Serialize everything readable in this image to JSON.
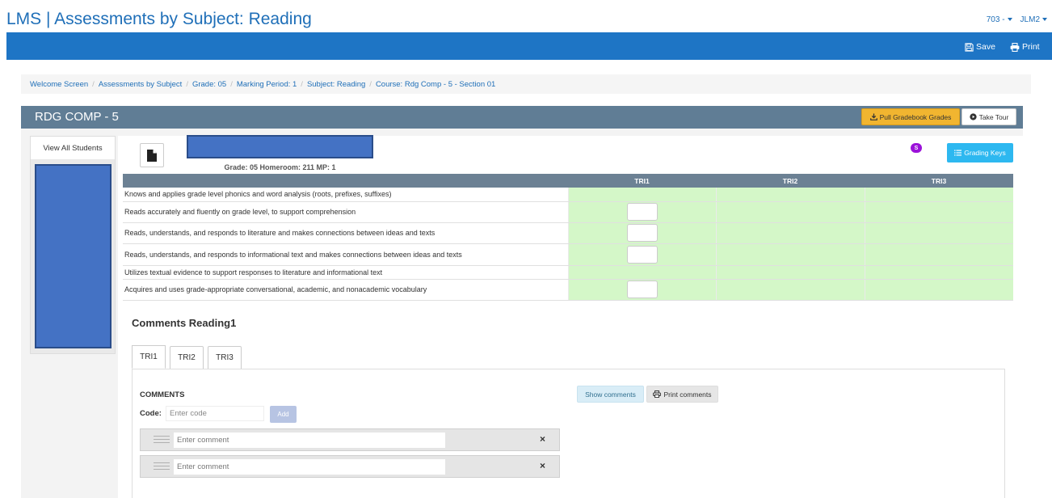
{
  "app": {
    "title": "LMS | Assessments by Subject: Reading"
  },
  "user_menu": {
    "school": "703 -",
    "user": "JLM2"
  },
  "navbar": {
    "save": "Save",
    "print": "Print"
  },
  "breadcrumb": [
    "Welcome Screen",
    "Assessments by Subject",
    "Grade: 05",
    "Marking Period: 1",
    "Subject: Reading",
    "Course: Rdg Comp - 5 - Section 01"
  ],
  "course": {
    "title": "RDG COMP - 5",
    "pull_label": "Pull Gradebook Grades",
    "tour_label": "Take Tour"
  },
  "sidebar": {
    "view_all": "View All Students"
  },
  "student": {
    "info": "Grade: 05   Homeroom: 211   MP: 1"
  },
  "grading": {
    "badge": "S",
    "keys_label": "Grading Keys"
  },
  "grid": {
    "headers": [
      "",
      "TRI1",
      "TRI2",
      "TRI3"
    ],
    "rows": [
      {
        "text": "Knows and applies grade level phonics and word analysis (roots, prefixes, suffixes)",
        "box": false
      },
      {
        "text": "Reads accurately and fluently on grade level, to support comprehension",
        "box": true
      },
      {
        "text": "Reads, understands, and responds to literature and makes connections between ideas and texts",
        "box": true
      },
      {
        "text": "Reads, understands, and responds to informational text and makes connections between ideas and texts",
        "box": true
      },
      {
        "text": "Utilizes textual evidence to support responses to literature and informational text",
        "box": false
      },
      {
        "text": "Acquires and uses grade-appropriate conversational, academic, and nonacademic vocabulary",
        "box": true
      }
    ]
  },
  "comments": {
    "title": "Comments Reading1",
    "tabs": [
      "TRI1",
      "TRI2",
      "TRI3"
    ],
    "label": "COMMENTS",
    "code_label": "Code:",
    "code_placeholder": "Enter code",
    "add_label": "Add",
    "show_label": "Show comments",
    "print_label": "Print comments",
    "comment_placeholder": "Enter comment",
    "remove_glyph": "×"
  },
  "colors": {
    "navbar": "#1e75c5",
    "panel_header": "#607d95",
    "grid_header": "#6c8194",
    "grade_cell": "#d4f7c8",
    "pull_button": "#f1b530",
    "keys_button": "#2db8f0",
    "badge": "#9b12d9",
    "redaction": "#4472c4"
  },
  "icons": {
    "save": "floppy-disk-icon",
    "print": "printer-icon",
    "pull": "download-icon",
    "tour": "play-circle-icon",
    "document": "document-icon",
    "keys": "list-icon",
    "drag": "drag-handle-icon",
    "remove": "close-icon"
  }
}
